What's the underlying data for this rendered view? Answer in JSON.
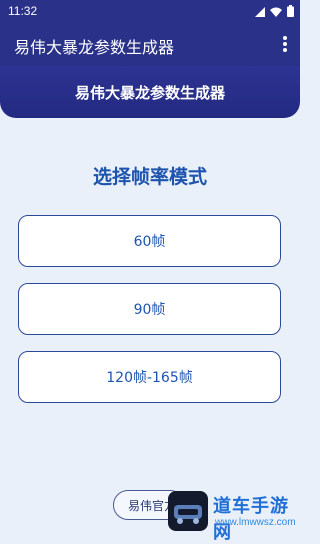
{
  "status_bar": {
    "time": "11:32",
    "icons": [
      "signal-icon",
      "wifi-icon",
      "battery-icon"
    ]
  },
  "app_bar": {
    "title": "易伟大暴龙参数生成器",
    "menu_icon": "more-vert-icon"
  },
  "header": {
    "banner_title": "易伟大暴龙参数生成器"
  },
  "main": {
    "section_title": "选择帧率模式",
    "options": [
      {
        "label": "60帧"
      },
      {
        "label": "90帧"
      },
      {
        "label": "120帧-165帧"
      }
    ]
  },
  "footer": {
    "official_button_label": "易伟官方"
  },
  "watermark": {
    "site_name": "道车手游网",
    "site_url": "www.lmwwsz.com"
  },
  "colors": {
    "primary_dark": "#2a3188",
    "accent_blue": "#1e54ad",
    "background": "#eaf0fa",
    "button_border": "#2a4a96"
  }
}
